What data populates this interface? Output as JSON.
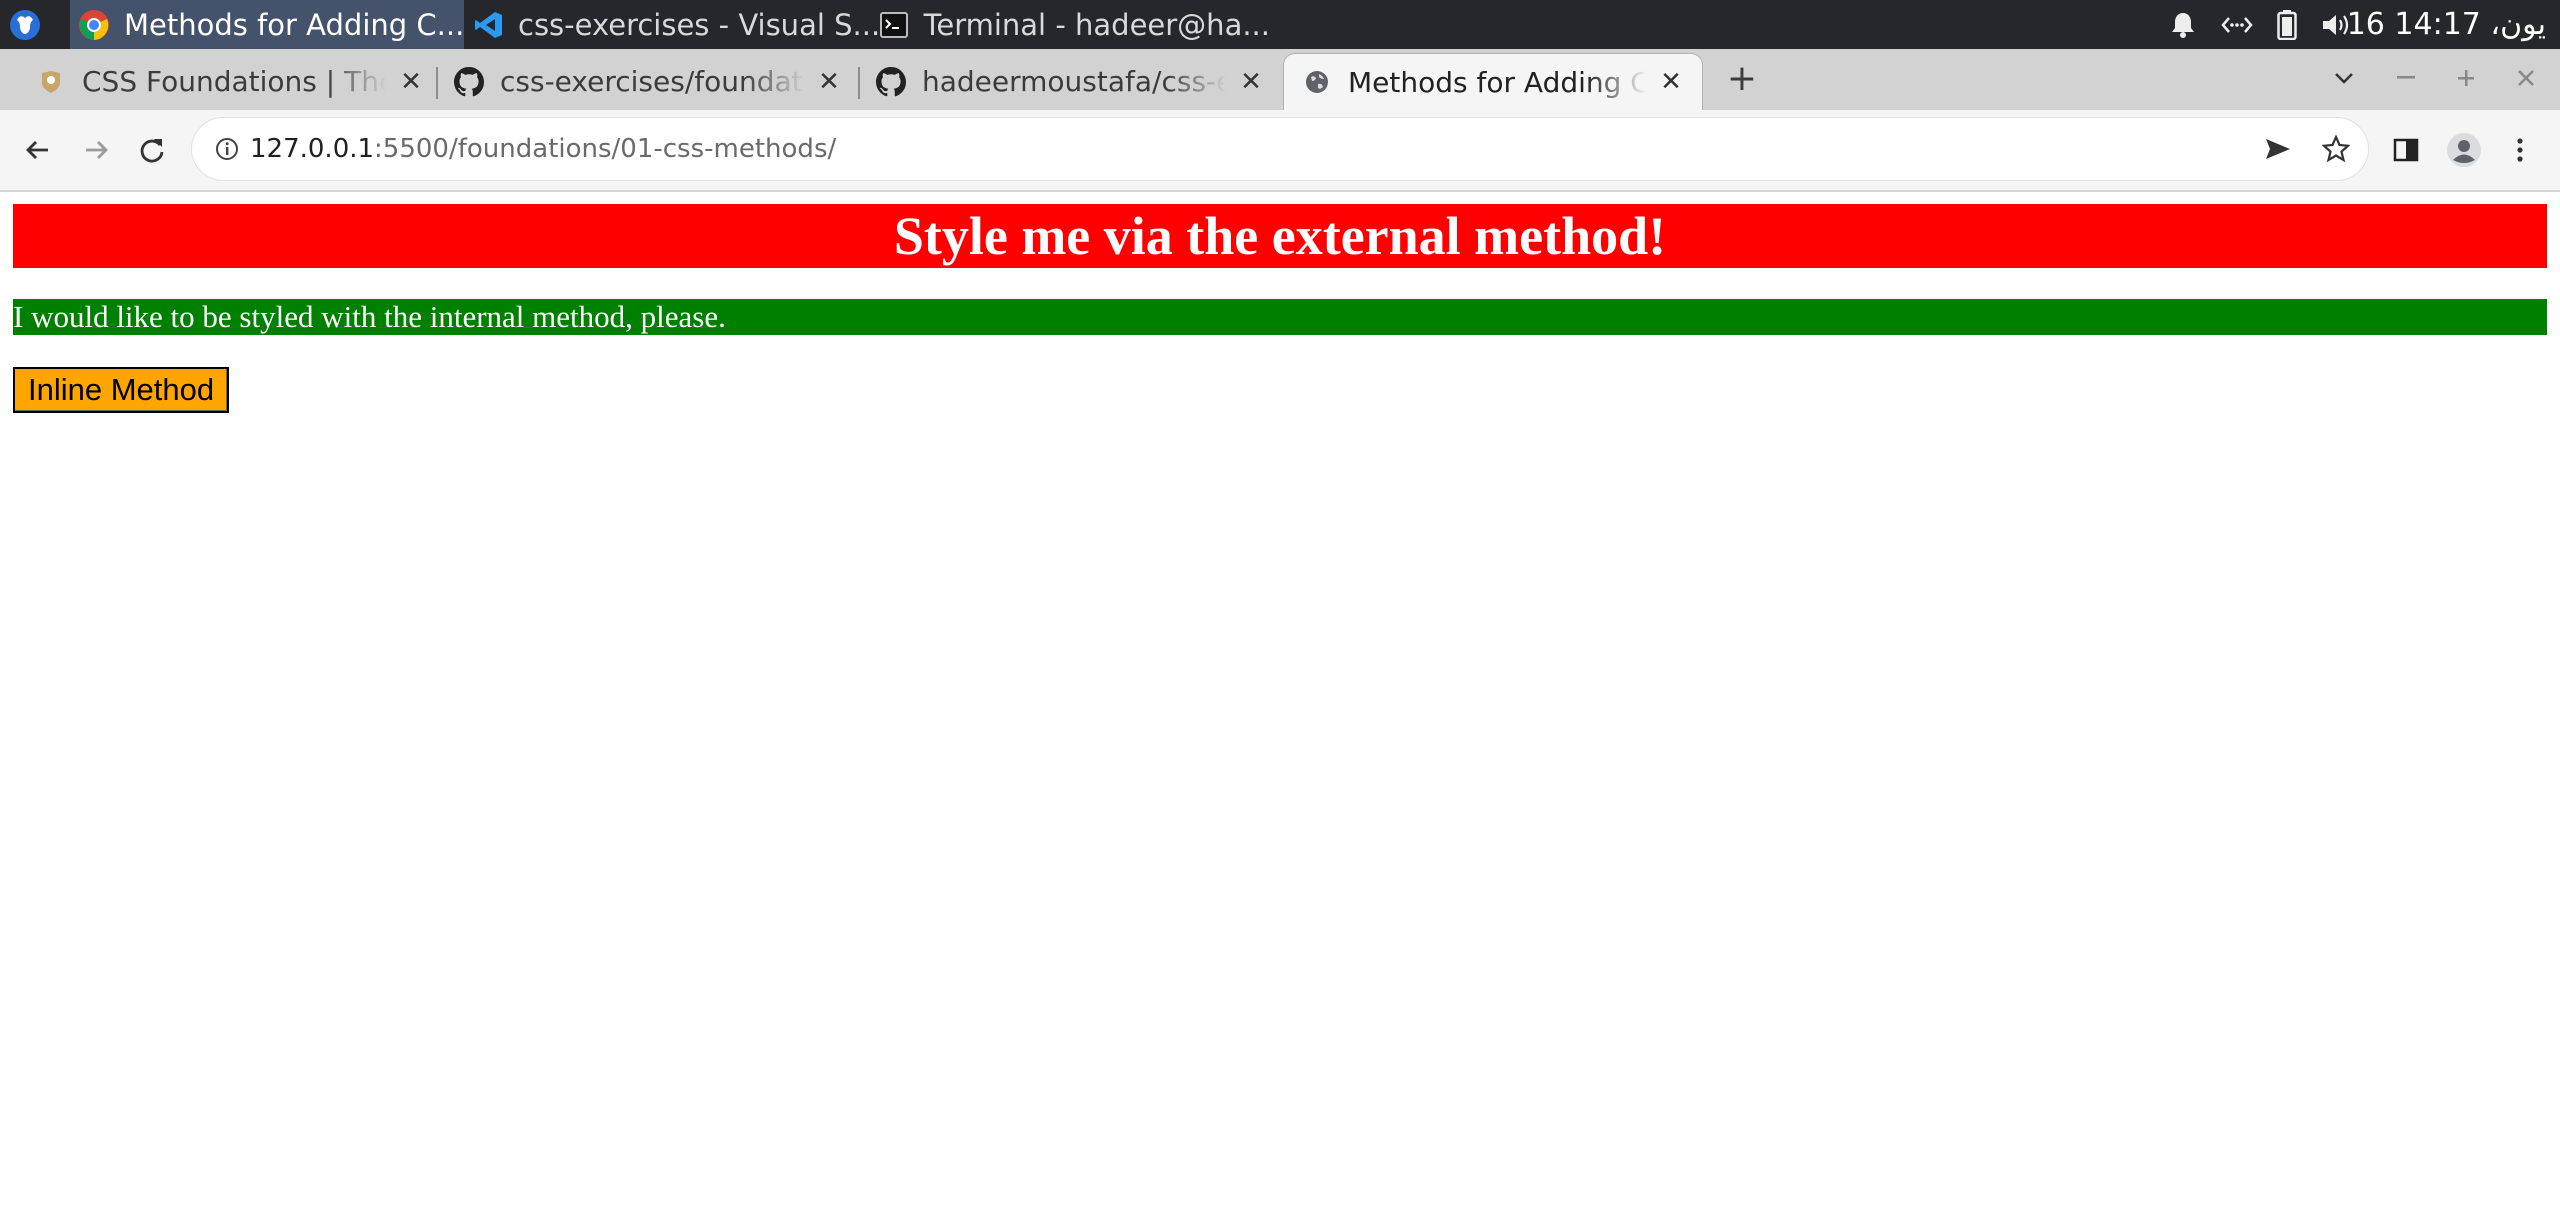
{
  "taskbar": {
    "tasks": [
      {
        "label": "Methods for Adding C...",
        "icon": "chrome-icon",
        "active": true
      },
      {
        "label": "css-exercises - Visual S...",
        "icon": "vscode-icon",
        "active": false
      },
      {
        "label": "Terminal - hadeer@ha...",
        "icon": "terminal-icon",
        "active": false
      }
    ],
    "clock": "16 يون، 14:17"
  },
  "browser": {
    "tabs": [
      {
        "title": "CSS Foundations | The Odin Project",
        "icon": "odin-icon",
        "active": false
      },
      {
        "title": "css-exercises/foundations",
        "icon": "github-icon",
        "active": false
      },
      {
        "title": "hadeermoustafa/css-exercises",
        "icon": "github-icon",
        "active": false
      },
      {
        "title": "Methods for Adding CSS",
        "icon": "globe-icon",
        "active": true
      }
    ],
    "url_host": "127.0.0.1",
    "url_rest": ":5500/foundations/01-css-methods/"
  },
  "page": {
    "heading": "Style me via the external method!",
    "paragraph": "I would like to be styled with the internal method, please.",
    "button": "Inline Method"
  },
  "colors": {
    "heading_bg": "#ff0000",
    "paragraph_bg": "#008000",
    "button_bg": "#ffa500"
  }
}
